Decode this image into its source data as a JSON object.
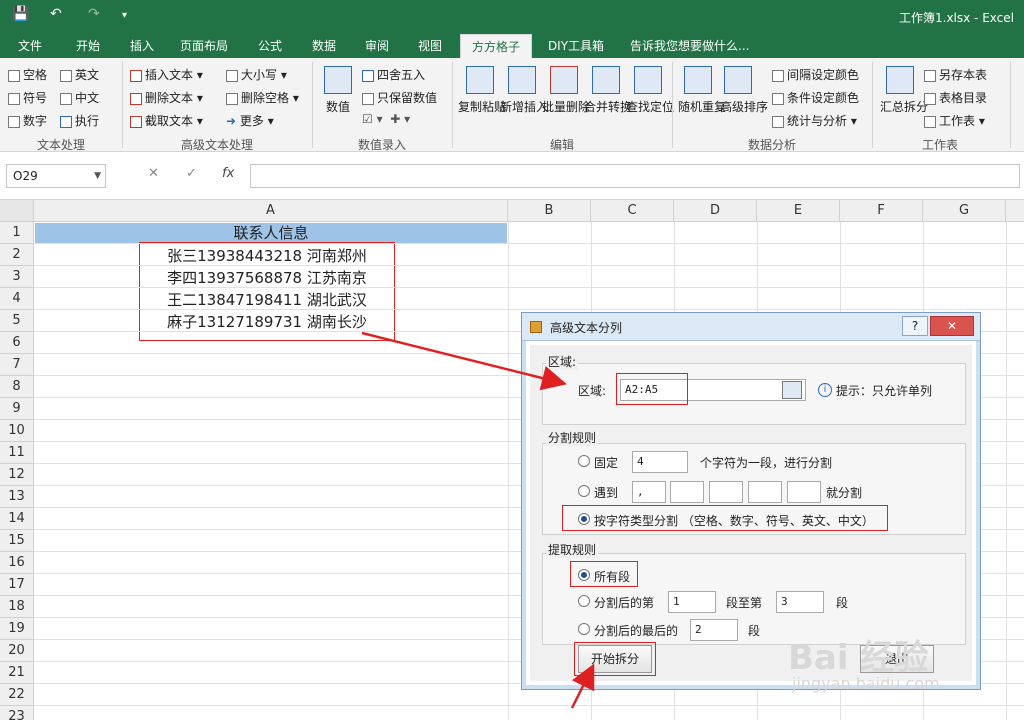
{
  "app": {
    "window_title": "工作簿1.xlsx - Excel",
    "tabs": [
      "文件",
      "开始",
      "插入",
      "页面布局",
      "公式",
      "数据",
      "审阅",
      "视图",
      "方方格子",
      "DIY工具箱",
      "告诉我您想要做什么..."
    ]
  },
  "ribbon": {
    "text_group": {
      "label": "文本处理",
      "items": [
        "空格",
        "英文",
        "符号",
        "中文",
        "数字",
        "执行"
      ]
    },
    "adv_text_group": {
      "label": "高级文本处理",
      "items": [
        "插入文本",
        "删除文本",
        "截取文本",
        "大小写",
        "删除空格",
        "更多"
      ]
    },
    "number_group": {
      "label": "数值录入",
      "items": [
        "数值",
        "四舍五入",
        "只保留数值"
      ]
    },
    "edit_group": {
      "label": "编辑",
      "items": [
        "复制粘贴",
        "新增插入",
        "批量删除",
        "合并转换",
        "查找定位"
      ]
    },
    "analysis_group": {
      "label": "数据分析",
      "items": [
        "随机重复",
        "高级排序",
        "间隔设定颜色",
        "条件设定颜色",
        "统计与分析"
      ]
    },
    "sheet_group": {
      "label": "工作表",
      "items": [
        "汇总拆分",
        "另存本表",
        "表格目录",
        "工作表"
      ]
    }
  },
  "formula_bar": {
    "name_box": "O29",
    "fx_label": "fx",
    "content": ""
  },
  "sheet": {
    "columns": [
      "A",
      "B",
      "C",
      "D",
      "E",
      "F",
      "G"
    ],
    "rows": [
      "1",
      "2",
      "3",
      "4",
      "5",
      "6",
      "7",
      "8",
      "9",
      "10",
      "11",
      "12",
      "13",
      "14",
      "15",
      "16",
      "17",
      "18",
      "19",
      "20",
      "21",
      "22",
      "23"
    ],
    "a1": "联系人信息",
    "data": [
      "张三13938443218 河南郑州",
      "李四13937568878  江苏南京",
      "王二13847198411 湖北武汉",
      "麻子13127189731  湖南长沙"
    ]
  },
  "dialog": {
    "title": "高级文本分列",
    "help": "?",
    "close": "✕",
    "region_section": "区域:",
    "region_label": "区域:",
    "region_value": "A2:A5",
    "region_hint": "提示：只允许单列",
    "split_section": "分割规则",
    "fixed_label": "固定",
    "fixed_value": "4",
    "fixed_suffix": "个字符为一段，进行分割",
    "meet_label": "遇到",
    "meet_value": ",",
    "meet_suffix": "就分割",
    "by_type_label": "按字符类型分割 （空格、数字、符号、英文、中文）",
    "extract_section": "提取规则",
    "all_segments": "所有段",
    "after_split_label": "分割后的第",
    "after_split_from": "1",
    "after_split_mid": "段至第",
    "after_split_to": "3",
    "after_split_end": "段",
    "last_label": "分割后的最后的",
    "last_value": "2",
    "last_end": "段",
    "start_button": "开始拆分",
    "exit_button": "退出"
  },
  "watermark": {
    "main": "Bai 经验",
    "sub": "jingyan.baidu.com"
  }
}
